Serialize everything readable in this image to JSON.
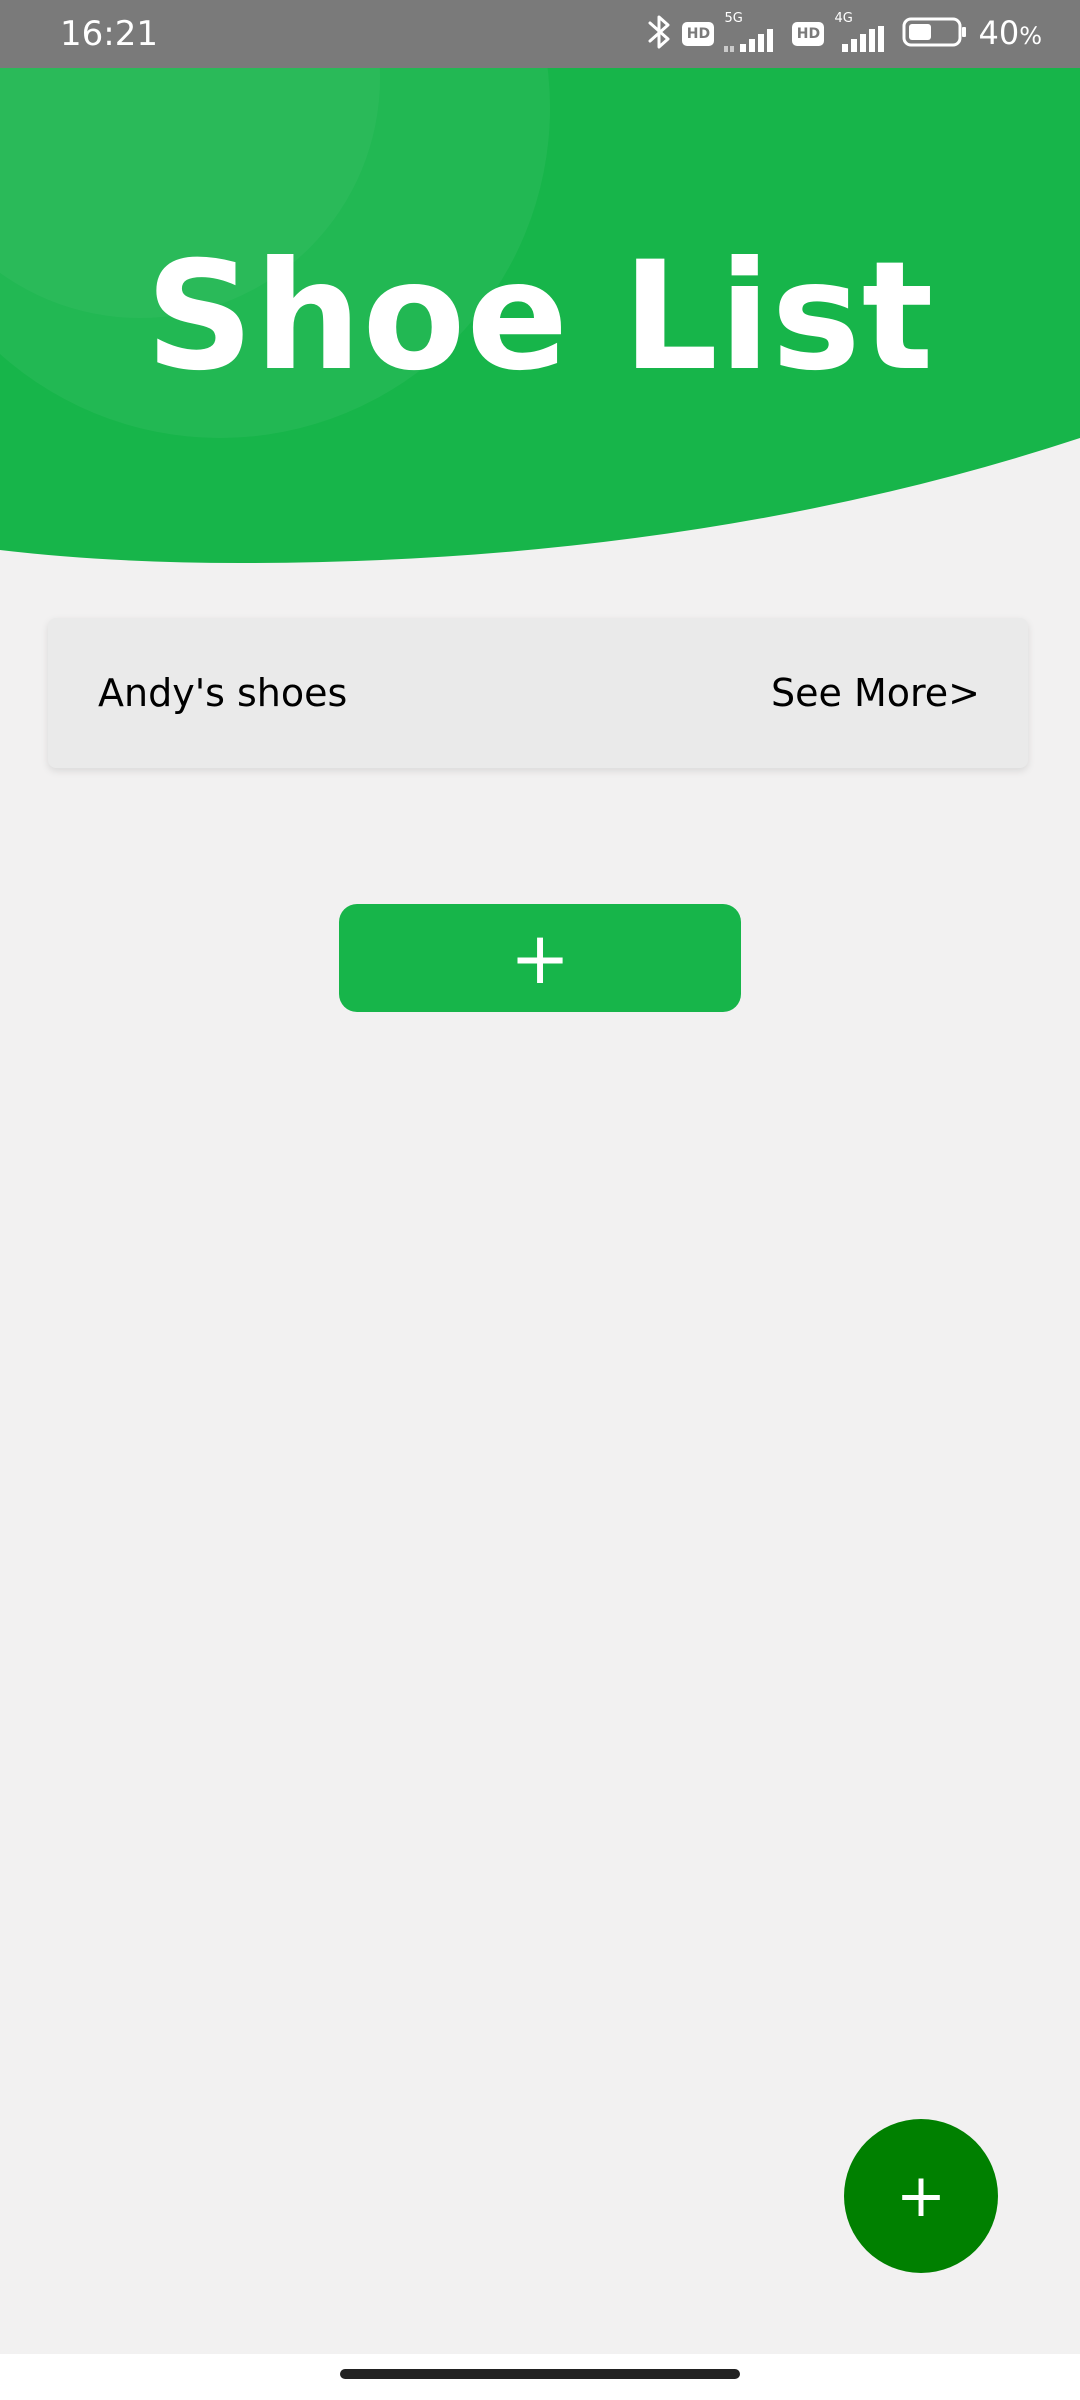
{
  "status_bar": {
    "time": "16:21",
    "hd_label": "HD",
    "network_1": "5G",
    "network_2": "4G",
    "battery": "40",
    "battery_unit": "%"
  },
  "header": {
    "title": "Shoe List"
  },
  "list": {
    "items": [
      {
        "title": "Andy's shoes",
        "link_label": "See More>"
      }
    ]
  },
  "add_button": {
    "label": "+"
  },
  "fab": {
    "label": "+"
  },
  "colors": {
    "brand_green": "#17b54a",
    "fab_green": "#008000",
    "background": "#f2f1f1",
    "status_bar": "#7a7a7a"
  }
}
